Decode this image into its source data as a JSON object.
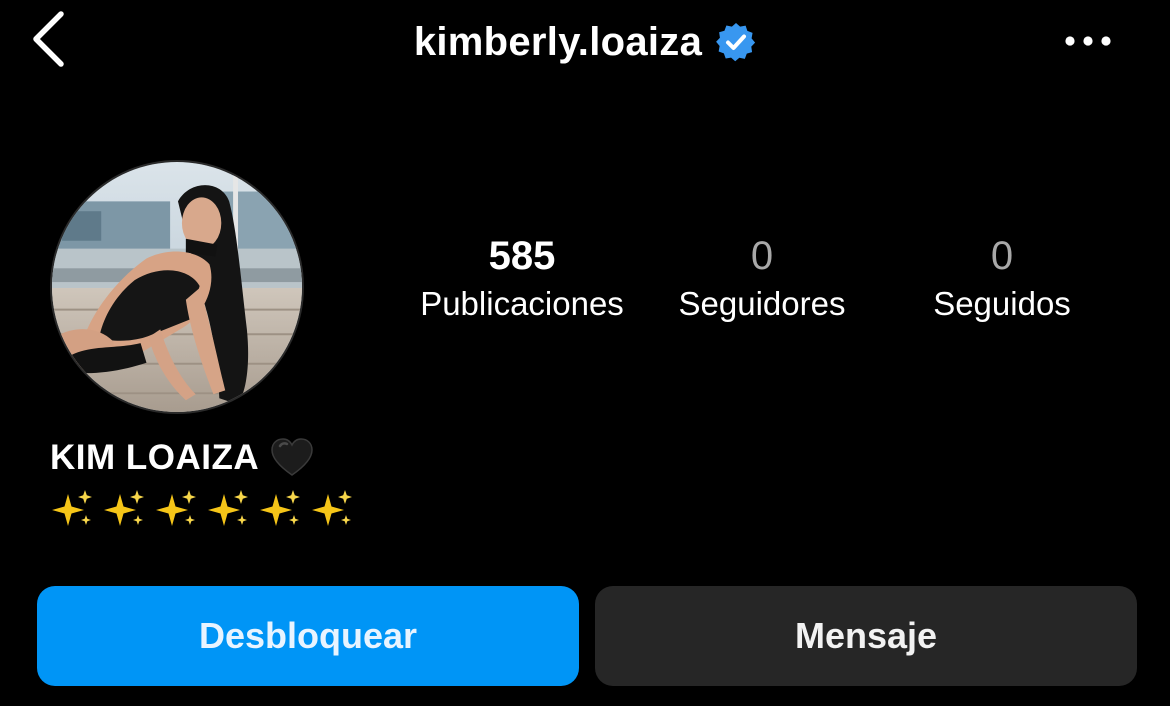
{
  "header": {
    "username": "kimberly.loaiza",
    "verified": true,
    "back_icon": "chevron-left-icon",
    "more_icon": "more-horizontal-icon"
  },
  "profile": {
    "avatar_icon": "profile-photo",
    "stats": {
      "posts": {
        "value": "585",
        "label": "Publicaciones"
      },
      "followers": {
        "value": "0",
        "label": "Seguidores"
      },
      "following": {
        "value": "0",
        "label": "Seguidos"
      }
    },
    "display_name": "KIM LOAIZA",
    "name_emoji": "black-heart-icon",
    "bio_emojis": [
      "sparkles-icon",
      "sparkles-icon",
      "sparkles-icon",
      "sparkles-icon",
      "sparkles-icon",
      "sparkles-icon"
    ]
  },
  "actions": {
    "unblock_label": "Desbloquear",
    "message_label": "Mensaje"
  },
  "colors": {
    "background": "#000000",
    "primary_button": "#0095f6",
    "secondary_button": "#262626",
    "verified_badge": "#3897f0",
    "muted_text": "#a8a8a8"
  }
}
